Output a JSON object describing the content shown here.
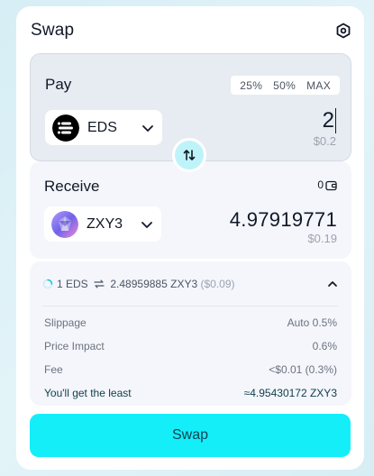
{
  "header": {
    "title": "Swap",
    "settings_icon": "settings-hex-icon"
  },
  "pay": {
    "label": "Pay",
    "percent_buttons": [
      "25%",
      "50%",
      "MAX"
    ],
    "token": {
      "symbol": "EDS",
      "icon": "eds-token-icon"
    },
    "amount": "2",
    "usd": "$0.2"
  },
  "receive": {
    "label": "Receive",
    "balance": "0",
    "token": {
      "symbol": "ZXY3",
      "icon": "zxy3-token-icon"
    },
    "amount": "4.97919771",
    "usd": "$0.19"
  },
  "details": {
    "rate_left": "1 EDS",
    "rate_right": "2.48959885 ZXY3",
    "rate_usd": "($0.09)",
    "rows": [
      {
        "label": "Slippage",
        "value": "Auto 0.5%"
      },
      {
        "label": "Price Impact",
        "value": "0.6%"
      },
      {
        "label": "Fee",
        "value": "<$0.01 (0.3%)"
      },
      {
        "label": "You'll get the least",
        "value": "≈4.95430172 ZXY3"
      }
    ]
  },
  "swap_button": "Swap",
  "colors": {
    "accent": "#14eef9",
    "swap_dir_bg": "#bff3fa"
  }
}
